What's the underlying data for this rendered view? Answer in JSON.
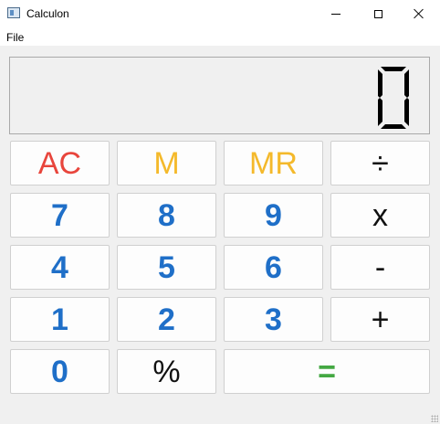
{
  "window": {
    "title": "Calculon"
  },
  "menu": {
    "file_label": "File"
  },
  "display": {
    "value": "0"
  },
  "buttons": {
    "ac": "AC",
    "m": "M",
    "mr": "MR",
    "divide": "÷",
    "seven": "7",
    "eight": "8",
    "nine": "9",
    "multiply": "x",
    "four": "4",
    "five": "5",
    "six": "6",
    "minus": "-",
    "one": "1",
    "two": "2",
    "three": "3",
    "plus": "+",
    "zero": "0",
    "percent": "%",
    "equals": "="
  },
  "colors": {
    "digit": "#1f6fc8",
    "clear": "#e8453c",
    "memory": "#f4b92b",
    "equals": "#44a843",
    "operator": "#111111"
  }
}
